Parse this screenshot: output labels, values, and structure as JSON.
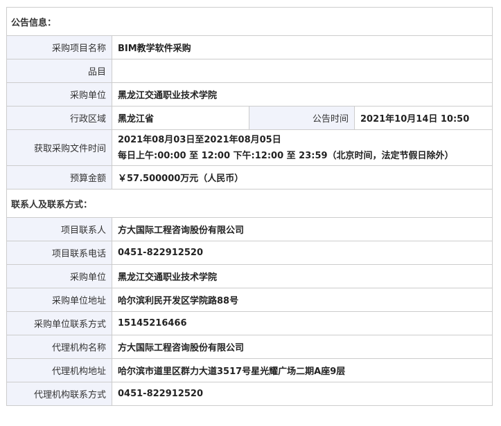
{
  "sections": {
    "announcement": "公告信息：",
    "contact": "联系人及联系方式："
  },
  "announcement": {
    "project_name_label": "采购项目名称",
    "project_name": "BIM教学软件采购",
    "category_label": "品目",
    "category": "",
    "purchaser_label": "采购单位",
    "purchaser": "黑龙江交通职业技术学院",
    "region_label": "行政区域",
    "region": "黑龙江省",
    "publish_time_label": "公告时间",
    "publish_time": "2021年10月14日 10:50",
    "doc_time_label": "获取采购文件时间",
    "doc_time_line1": "2021年08月03日至2021年08月05日",
    "doc_time_line2": "每日上午:00:00 至 12:00  下午:12:00 至 23:59（北京时间，法定节假日除外）",
    "budget_label": "预算金额",
    "budget": "￥57.500000万元（人民币）"
  },
  "contact": {
    "project_contact_label": "项目联系人",
    "project_contact": "方大国际工程咨询股份有限公司",
    "project_phone_label": "项目联系电话",
    "project_phone": "0451-822912520",
    "purchaser_label": "采购单位",
    "purchaser": "黑龙江交通职业技术学院",
    "purchaser_address_label": "采购单位地址",
    "purchaser_address": "哈尔滨利民开发区学院路88号",
    "purchaser_contact_label": "采购单位联系方式",
    "purchaser_contact": "15145216466",
    "agency_name_label": "代理机构名称",
    "agency_name": "方大国际工程咨询股份有限公司",
    "agency_address_label": "代理机构地址",
    "agency_address": "哈尔滨市道里区群力大道3517号星光耀广场二期A座9层",
    "agency_contact_label": "代理机构联系方式",
    "agency_contact": "0451-822912520"
  }
}
